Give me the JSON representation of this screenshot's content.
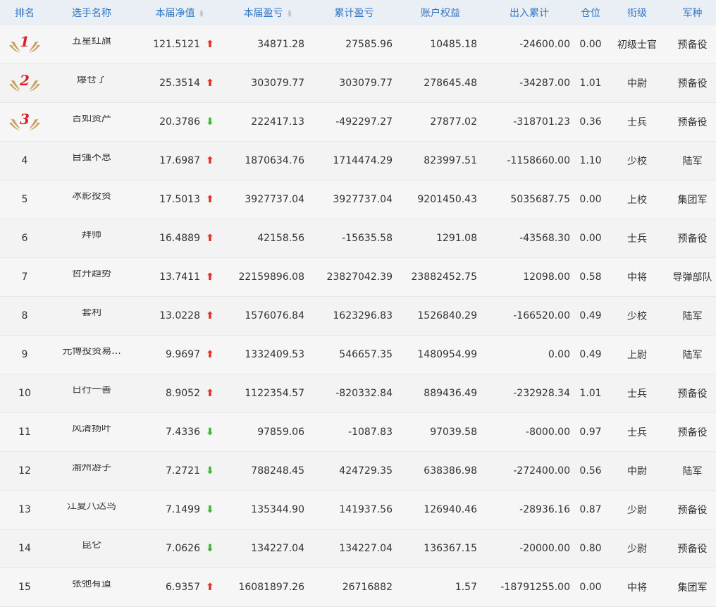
{
  "colors": {
    "header_bg": "#eaeff5",
    "header_text": "#2f75c2",
    "up": "#e0312a",
    "down": "#3cb52f",
    "medal_digit": "#d6232a",
    "wing": "#c9a060"
  },
  "headers": {
    "rank": "排名",
    "name": "选手名称",
    "nav": "本届净值",
    "pnl": "本届盈亏",
    "cum_pnl": "累计盈亏",
    "equity": "账户权益",
    "flow": "出入累计",
    "position": "仓位",
    "title": "衔级",
    "arm": "军种"
  },
  "rows": [
    {
      "rank": "1",
      "medal": true,
      "name": "五星红旗",
      "nav": "121.5121",
      "trend": "up",
      "pnl": "34871.28",
      "cum_pnl": "27585.96",
      "equity": "10485.18",
      "flow": "-24600.00",
      "position": "0.00",
      "title": "初级士官",
      "arm": "预备役"
    },
    {
      "rank": "2",
      "medal": true,
      "name": "爆仓了",
      "nav": "25.3514",
      "trend": "up",
      "pnl": "303079.77",
      "cum_pnl": "303079.77",
      "equity": "278645.48",
      "flow": "-34287.00",
      "position": "1.01",
      "title": "中尉",
      "arm": "预备役"
    },
    {
      "rank": "3",
      "medal": true,
      "name": "吉如资产",
      "nav": "20.3786",
      "trend": "down",
      "pnl": "222417.13",
      "cum_pnl": "-492297.27",
      "equity": "27877.02",
      "flow": "-318701.23",
      "position": "0.36",
      "title": "士兵",
      "arm": "预备役"
    },
    {
      "rank": "4",
      "medal": false,
      "name": "自强不息",
      "nav": "17.6987",
      "trend": "up",
      "pnl": "1870634.76",
      "cum_pnl": "1714474.29",
      "equity": "823997.51",
      "flow": "-1158660.00",
      "position": "1.10",
      "title": "少校",
      "arm": "陆军"
    },
    {
      "rank": "5",
      "medal": false,
      "name": "冰影投资",
      "nav": "17.5013",
      "trend": "up",
      "pnl": "3927737.04",
      "cum_pnl": "3927737.04",
      "equity": "9201450.43",
      "flow": "5035687.75",
      "position": "0.00",
      "title": "上校",
      "arm": "集团军"
    },
    {
      "rank": "6",
      "medal": false,
      "name": "拜师",
      "nav": "16.4889",
      "trend": "up",
      "pnl": "42158.56",
      "cum_pnl": "-15635.58",
      "equity": "1291.08",
      "flow": "-43568.30",
      "position": "0.00",
      "title": "士兵",
      "arm": "预备役"
    },
    {
      "rank": "7",
      "medal": false,
      "name": "哲升趋势",
      "nav": "13.7411",
      "trend": "up",
      "pnl": "22159896.08",
      "cum_pnl": "23827042.39",
      "equity": "23882452.75",
      "flow": "12098.00",
      "position": "0.58",
      "title": "中将",
      "arm": "导弹部队"
    },
    {
      "rank": "8",
      "medal": false,
      "name": "套利",
      "nav": "13.0228",
      "trend": "up",
      "pnl": "1576076.84",
      "cum_pnl": "1623296.83",
      "equity": "1526840.29",
      "flow": "-166520.00",
      "position": "0.49",
      "title": "少校",
      "arm": "陆军"
    },
    {
      "rank": "9",
      "medal": false,
      "name": "元博投资易...",
      "nav": "9.9697",
      "trend": "up",
      "pnl": "1332409.53",
      "cum_pnl": "546657.35",
      "equity": "1480954.99",
      "flow": "0.00",
      "position": "0.49",
      "title": "上尉",
      "arm": "陆军"
    },
    {
      "rank": "10",
      "medal": false,
      "name": "日行一善",
      "nav": "8.9052",
      "trend": "up",
      "pnl": "1122354.57",
      "cum_pnl": "-820332.84",
      "equity": "889436.49",
      "flow": "-232928.34",
      "position": "1.01",
      "title": "士兵",
      "arm": "预备役"
    },
    {
      "rank": "11",
      "medal": false,
      "name": "风清扬叶",
      "nav": "7.4336",
      "trend": "down",
      "pnl": "97859.06",
      "cum_pnl": "-1087.83",
      "equity": "97039.58",
      "flow": "-8000.00",
      "position": "0.97",
      "title": "士兵",
      "arm": "预备役"
    },
    {
      "rank": "12",
      "medal": false,
      "name": "渝州游子",
      "nav": "7.2721",
      "trend": "down",
      "pnl": "788248.45",
      "cum_pnl": "424729.35",
      "equity": "638386.98",
      "flow": "-272400.00",
      "position": "0.56",
      "title": "中尉",
      "arm": "陆军"
    },
    {
      "rank": "13",
      "medal": false,
      "name": "江夏八达鸟",
      "nav": "7.1499",
      "trend": "down",
      "pnl": "135344.90",
      "cum_pnl": "141937.56",
      "equity": "126940.46",
      "flow": "-28936.16",
      "position": "0.87",
      "title": "少尉",
      "arm": "预备役"
    },
    {
      "rank": "14",
      "medal": false,
      "name": "昆仑",
      "nav": "7.0626",
      "trend": "down",
      "pnl": "134227.04",
      "cum_pnl": "134227.04",
      "equity": "136367.15",
      "flow": "-20000.00",
      "position": "0.80",
      "title": "少尉",
      "arm": "预备役"
    },
    {
      "rank": "15",
      "medal": false,
      "name": "张弛有道",
      "nav": "6.9357",
      "trend": "up",
      "pnl": "16081897.26",
      "cum_pnl": "26716882",
      "equity": "1.57",
      "flow": "-18791255.00",
      "position": "0.00",
      "title": "中将",
      "arm": "集团军"
    }
  ]
}
